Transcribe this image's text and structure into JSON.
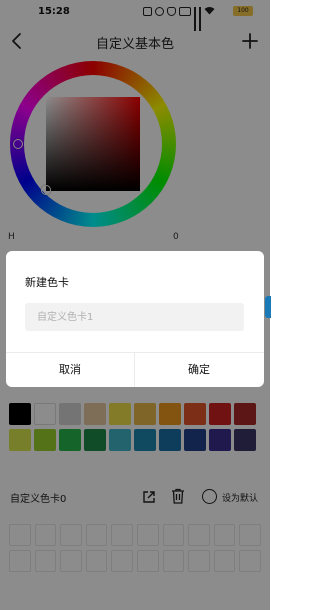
{
  "status_bar": {
    "time": "15:28",
    "battery": "100",
    "icons": [
      "nfc-icon",
      "alarm-icon",
      "mute-icon",
      "hd-icon",
      "signal-icon",
      "signal-icon",
      "wifi-icon"
    ]
  },
  "header": {
    "title": "自定义基本色"
  },
  "picker": {
    "hue_label": "H",
    "hue_value": "0"
  },
  "swatches": {
    "row1": [
      "#000000",
      "#ffffff",
      "#d4d4d4",
      "#e6c9a1",
      "#f0e04a",
      "#e7b94a",
      "#ee9a1e",
      "#e2552a",
      "#cc2222",
      "#aa2929"
    ],
    "row2": [
      "#d9e84d",
      "#9ad02b",
      "#27b64e",
      "#1e8a4a",
      "#3fb5c9",
      "#1e88b0",
      "#1a6ea6",
      "#22418a",
      "#3a2e8f",
      "#3a3564"
    ]
  },
  "color_card": {
    "name": "自定义色卡0",
    "set_default_label": "设为默认"
  },
  "dialog": {
    "title": "新建色卡",
    "input_placeholder": "自定义色卡1",
    "input_value": "",
    "cancel_label": "取消",
    "confirm_label": "确定"
  }
}
